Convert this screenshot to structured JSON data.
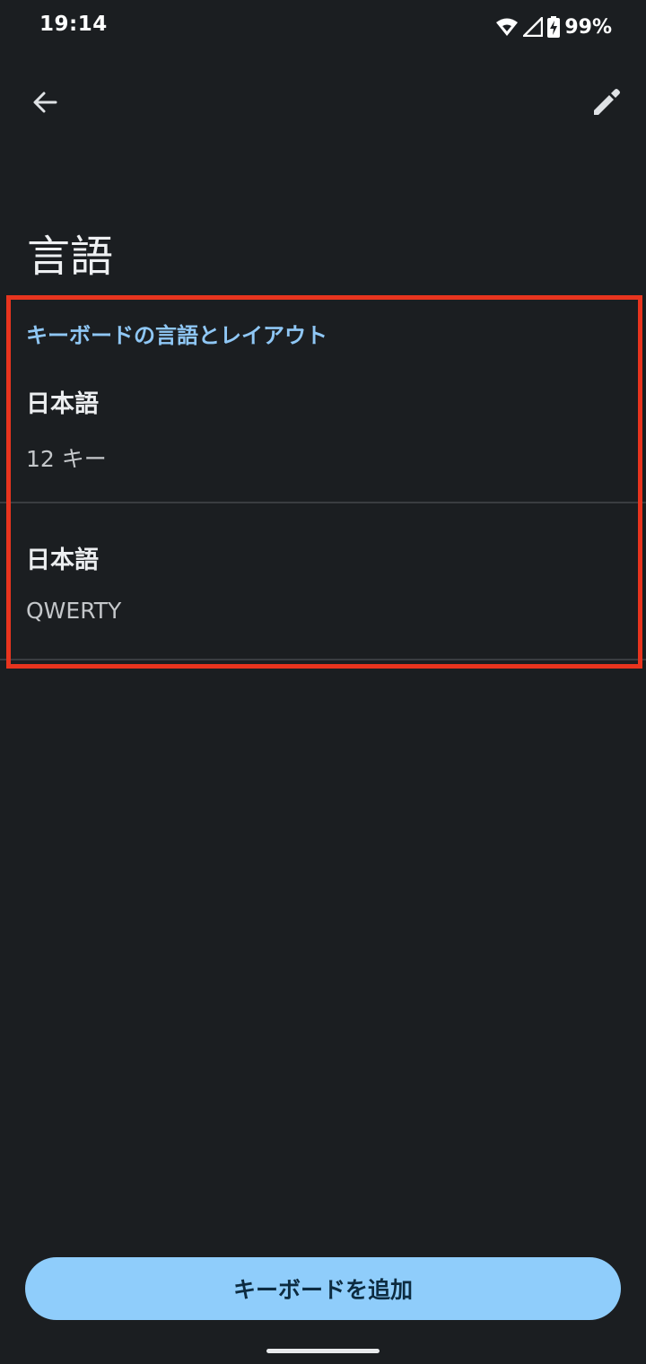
{
  "status_bar": {
    "time": "19:14",
    "battery": "99%",
    "icons": [
      "wifi-icon",
      "signal-icon",
      "battery-charging-icon"
    ]
  },
  "app_bar": {
    "back_icon": "arrow-back-icon",
    "edit_icon": "pencil-icon"
  },
  "page": {
    "title": "言語"
  },
  "section": {
    "header": "キーボードの言語とレイアウト",
    "items": [
      {
        "title": "日本語",
        "subtitle": "12 キー"
      },
      {
        "title": "日本語",
        "subtitle": "QWERTY"
      }
    ]
  },
  "footer": {
    "add_button_label": "キーボードを追加"
  },
  "colors": {
    "background": "#1b1e21",
    "accent": "#8fc7f5",
    "button": "#8fcdfb",
    "highlight": "#e8341e"
  }
}
